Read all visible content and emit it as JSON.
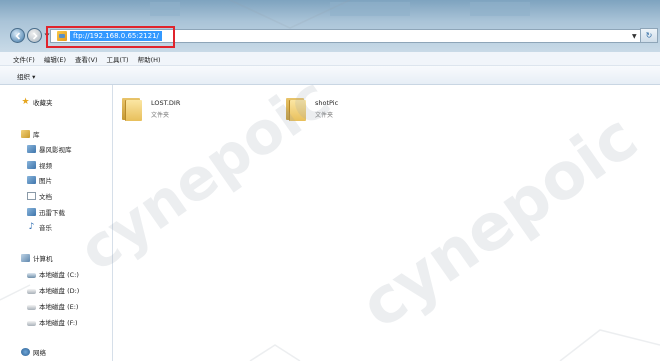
{
  "address_bar": {
    "url": "ftp://192.168.0.65:2121/",
    "highlight_color": "#e0242c",
    "selection_color": "#3399ff"
  },
  "menu": [
    "文件(F)",
    "编辑(E)",
    "查看(V)",
    "工具(T)",
    "帮助(H)"
  ],
  "toolbar": {
    "organize_label": "组织 ▾"
  },
  "sidebar": {
    "favorites": {
      "label": "收藏夹",
      "icon": "star-icon"
    },
    "libraries": {
      "label": "库",
      "items": [
        {
          "label": "暴风影视库",
          "icon": "video-library-icon"
        },
        {
          "label": "视频",
          "icon": "video-icon"
        },
        {
          "label": "图片",
          "icon": "picture-icon"
        },
        {
          "label": "文档",
          "icon": "document-icon"
        },
        {
          "label": "迅雷下载",
          "icon": "download-icon"
        },
        {
          "label": "音乐",
          "icon": "music-icon"
        }
      ]
    },
    "computer": {
      "label": "计算机",
      "drives": [
        {
          "label": "本地磁盘 (C:)"
        },
        {
          "label": "本地磁盘 (D:)"
        },
        {
          "label": "本地磁盘 (E:)"
        },
        {
          "label": "本地磁盘 (F:)"
        }
      ]
    },
    "network": {
      "label": "网络"
    }
  },
  "folders": [
    {
      "name": "LOST.DIR",
      "type": "文件夹"
    },
    {
      "name": "shotPic",
      "type": "文件夹"
    }
  ],
  "watermark_text": "cynepoic"
}
